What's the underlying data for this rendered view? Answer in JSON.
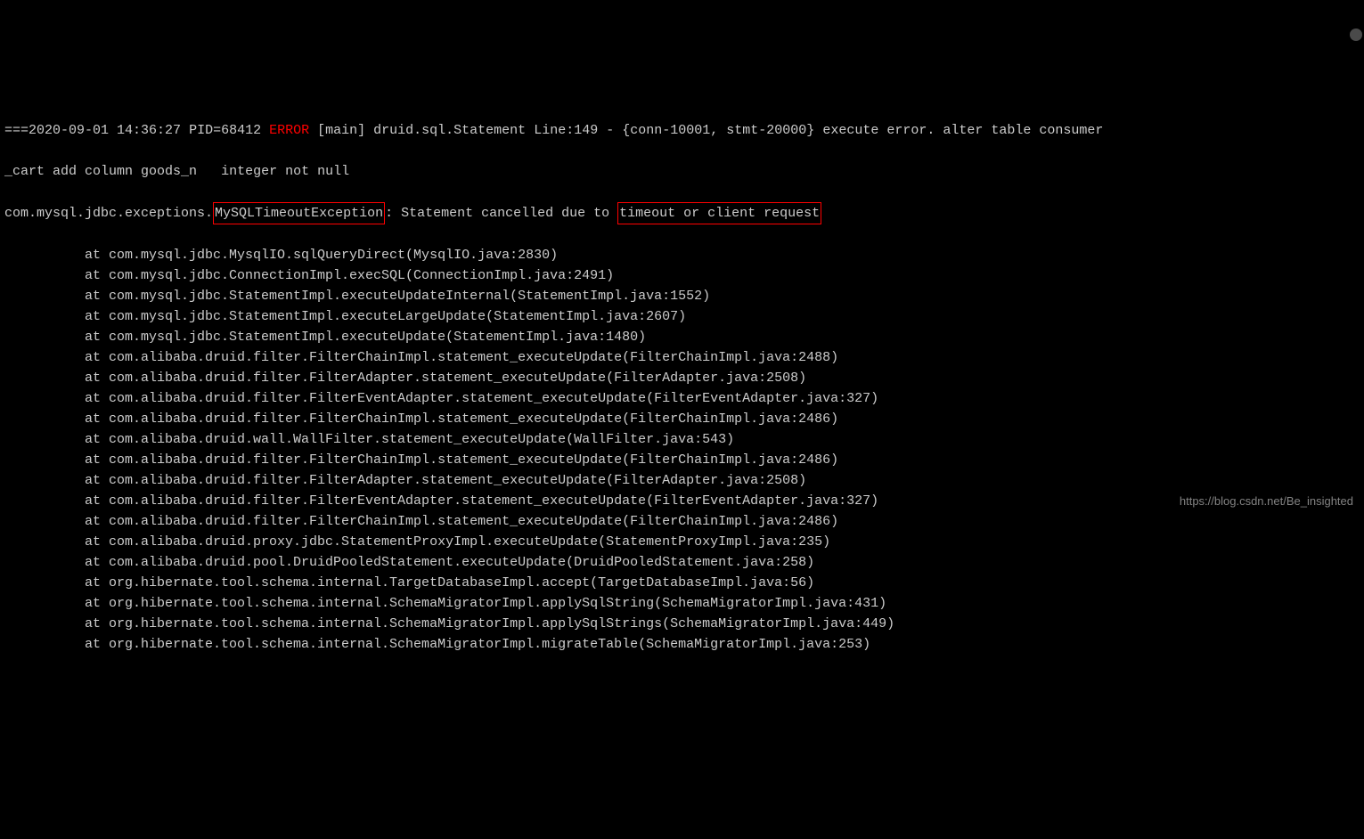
{
  "header": {
    "prefix": "===",
    "timestamp": "2020-09-01 14:36:27",
    "pid": "PID=68412",
    "level": "ERROR",
    "thread": "[main]",
    "logger": "druid.sql.Statement",
    "line": "Line:149",
    "separator": "-",
    "context": "{conn-10001, stmt-20000}",
    "message": "execute error.",
    "sql_part1": "alter table consumer",
    "sql_part2": "_cart add column goods_n",
    "sql_part3": "integer not null"
  },
  "exception": {
    "package": "com.mysql.jdbc.exceptions.",
    "class": "MySQLTimeoutException",
    "colon": ":",
    "message_prefix": " Statement cancelled due to ",
    "message_highlight": "timeout or client request"
  },
  "stacktrace": [
    "at com.mysql.jdbc.MysqlIO.sqlQueryDirect(MysqlIO.java:2830)",
    "at com.mysql.jdbc.ConnectionImpl.execSQL(ConnectionImpl.java:2491)",
    "at com.mysql.jdbc.StatementImpl.executeUpdateInternal(StatementImpl.java:1552)",
    "at com.mysql.jdbc.StatementImpl.executeLargeUpdate(StatementImpl.java:2607)",
    "at com.mysql.jdbc.StatementImpl.executeUpdate(StatementImpl.java:1480)",
    "at com.alibaba.druid.filter.FilterChainImpl.statement_executeUpdate(FilterChainImpl.java:2488)",
    "at com.alibaba.druid.filter.FilterAdapter.statement_executeUpdate(FilterAdapter.java:2508)",
    "at com.alibaba.druid.filter.FilterEventAdapter.statement_executeUpdate(FilterEventAdapter.java:327)",
    "at com.alibaba.druid.filter.FilterChainImpl.statement_executeUpdate(FilterChainImpl.java:2486)",
    "at com.alibaba.druid.wall.WallFilter.statement_executeUpdate(WallFilter.java:543)",
    "at com.alibaba.druid.filter.FilterChainImpl.statement_executeUpdate(FilterChainImpl.java:2486)",
    "at com.alibaba.druid.filter.FilterAdapter.statement_executeUpdate(FilterAdapter.java:2508)",
    "at com.alibaba.druid.filter.FilterEventAdapter.statement_executeUpdate(FilterEventAdapter.java:327)",
    "at com.alibaba.druid.filter.FilterChainImpl.statement_executeUpdate(FilterChainImpl.java:2486)",
    "at com.alibaba.druid.proxy.jdbc.StatementProxyImpl.executeUpdate(StatementProxyImpl.java:235)",
    "at com.alibaba.druid.pool.DruidPooledStatement.executeUpdate(DruidPooledStatement.java:258)",
    "at org.hibernate.tool.schema.internal.TargetDatabaseImpl.accept(TargetDatabaseImpl.java:56)",
    "at org.hibernate.tool.schema.internal.SchemaMigratorImpl.applySqlString(SchemaMigratorImpl.java:431)",
    "at org.hibernate.tool.schema.internal.SchemaMigratorImpl.applySqlStrings(SchemaMigratorImpl.java:449)",
    "at org.hibernate.tool.schema.internal.SchemaMigratorImpl.migrateTable(SchemaMigratorImpl.java:253)"
  ],
  "watermark": "https://blog.csdn.net/Be_insighted"
}
